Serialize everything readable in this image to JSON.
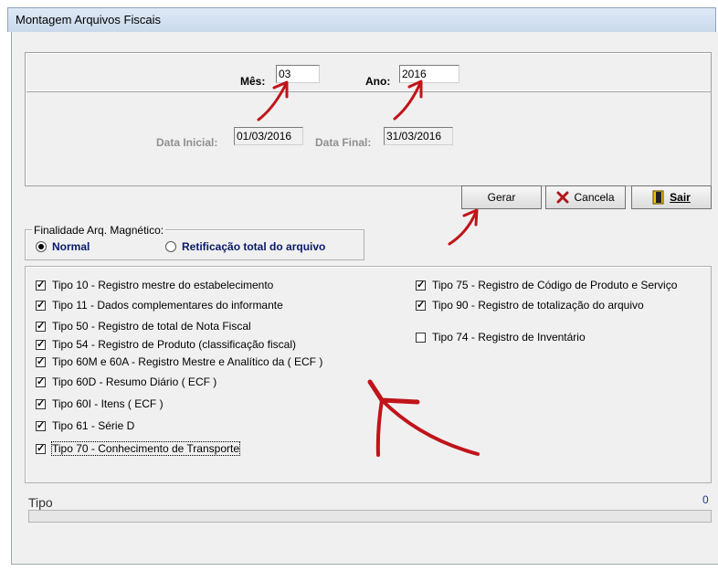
{
  "window": {
    "title": "Montagem Arquivos Fiscais"
  },
  "period": {
    "mes_label": "Mês:",
    "mes_value": "03",
    "ano_label": "Ano:",
    "ano_value": "2016",
    "data_inicial_label": "Data Inicial:",
    "data_inicial_value": "01/03/2016",
    "data_final_label": "Data Final:",
    "data_final_value": "31/03/2016"
  },
  "buttons": {
    "gerar": "Gerar",
    "cancela": "Cancela",
    "sair": "Sair"
  },
  "finalidade": {
    "legend": "Finalidade Arq. Magnético:",
    "options": [
      {
        "label": "Normal",
        "selected": true
      },
      {
        "label": "Retificação total do arquivo",
        "selected": false
      }
    ]
  },
  "tipos_left": [
    {
      "label": "Tipo 10 - Registro mestre do estabelecimento",
      "checked": true
    },
    {
      "label": "Tipo 11 - Dados complementares do informante",
      "checked": true
    },
    {
      "label": "Tipo 50 - Registro de total de Nota Fiscal",
      "checked": true
    },
    {
      "label": "Tipo 54 - Registro de Produto (classificação fiscal)",
      "checked": true
    },
    {
      "label": "Tipo 60M e 60A - Registro Mestre e Analítico da ( ECF )",
      "checked": true
    },
    {
      "label": "Tipo 60D - Resumo Diário ( ECF )",
      "checked": true
    },
    {
      "label": "Tipo 60I - Itens ( ECF )",
      "checked": true
    },
    {
      "label": "Tipo 61 - Série D",
      "checked": true
    },
    {
      "label": "Tipo 70 - Conhecimento de Transporte",
      "checked": true
    }
  ],
  "tipos_right": [
    {
      "label": "Tipo 75 - Registro de Código de Produto e Serviço",
      "checked": true
    },
    {
      "label": "Tipo 90 - Registro de totalização do arquivo",
      "checked": true
    },
    {
      "label": "Tipo 74 - Registro de Inventário",
      "checked": false
    }
  ],
  "status": {
    "label": "Tipo",
    "count": "0",
    "progress": 0
  },
  "colors": {
    "annotation_arrow": "#c0141a"
  }
}
